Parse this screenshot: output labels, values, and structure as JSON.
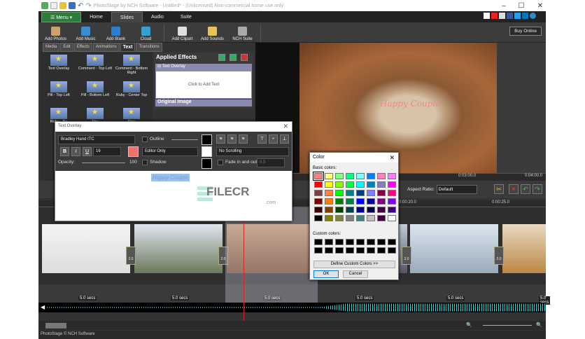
{
  "window": {
    "title": "PhotoStage by NCH Software - Untitled* - (Unlicensed) Non-commercial home use only"
  },
  "menu": {
    "menu_label": "☰ Menu ▾",
    "tabs": [
      "Home",
      "Slides",
      "Audio",
      "Suite"
    ],
    "active_tab": "Slides"
  },
  "toolbar": {
    "buttons": [
      {
        "label": "Add Photos",
        "color": "#c9a36b"
      },
      {
        "label": "Add Music",
        "color": "#3a8fd0"
      },
      {
        "label": "Add Blank",
        "color": "#2a7fd0"
      },
      {
        "label": "Cloud",
        "color": "#3a9fd0"
      },
      {
        "label": "Add Clipart",
        "color": "#e0e0e0"
      },
      {
        "label": "Add Sounds",
        "color": "#e6c450"
      },
      {
        "label": "NCH Suite",
        "color": "#aaaaaa"
      }
    ],
    "buy_online": "Buy Online"
  },
  "left_tabs": [
    "Media",
    "Edit",
    "Effects",
    "Animations",
    "Text",
    "Transitions"
  ],
  "active_left_tab": "Text",
  "effects": [
    "Text Overlay",
    "Comment - Top Left",
    "Comment - Bottom Right",
    "Pill - Top Left",
    "Pill - Bottom Left",
    "Ruby - Center Top",
    "Ruby - Bo",
    "The",
    "Stop"
  ],
  "applied": {
    "title": "Applied Effects",
    "overlay": "⊟ Text Overlay",
    "click_to_add": "Click to Add Text",
    "original": "Original Image"
  },
  "preview": {
    "overlay_text": "Happy Couple",
    "ruler": [
      "0:03:00.0",
      "0:04:00.0"
    ]
  },
  "controls": {
    "aspect_label": "Aspect Ratio:",
    "aspect_value": "Default"
  },
  "timeline": {
    "ruler": [
      "0:00:20.0",
      "0:00:25.0"
    ],
    "durations": [
      "5.0 secs",
      "5.0 secs",
      "5.0 secs",
      "5.0 secs",
      "5.0 secs",
      "5.0 secs"
    ],
    "transition_value": "2.0"
  },
  "status": "PhotoStage © NCH Software",
  "text_overlay_dialog": {
    "title": "Text Overlay",
    "font": "Bradley Hand ITC",
    "size": "16",
    "outline": "Outline",
    "mode": "Editor Only",
    "shadow": "Shadow",
    "opacity_label": "Opacity:",
    "opacity_value": "100",
    "opacity": 1.0,
    "scrolling": "No Scrolling",
    "fade": "Fade in and out",
    "fade_value": "0.5",
    "text": "Happy Couple",
    "text_color": "#f07070",
    "bold": "B",
    "italic": "I",
    "underline": "U"
  },
  "watermark": {
    "text": "FILECR",
    "sub": ".com"
  },
  "color_dialog": {
    "title": "Color",
    "basic_label": "Basic colors:",
    "custom_label": "Custom colors:",
    "define_label": "Define Custom Colors >>",
    "ok": "OK",
    "cancel": "Cancel",
    "basic": [
      "#FF8080",
      "#FFFF80",
      "#80FF80",
      "#00FF80",
      "#80FFFF",
      "#0080FF",
      "#FF80C0",
      "#FF80FF",
      "#FF0000",
      "#FFFF00",
      "#80FF00",
      "#00FF40",
      "#00FFFF",
      "#0080C0",
      "#8080C0",
      "#FF00FF",
      "#804040",
      "#FF8040",
      "#00FF00",
      "#008080",
      "#004080",
      "#8080FF",
      "#800040",
      "#FF0080",
      "#800000",
      "#FF8000",
      "#008000",
      "#008040",
      "#0000FF",
      "#0000A0",
      "#800080",
      "#8000FF",
      "#400000",
      "#804000",
      "#004000",
      "#004040",
      "#000080",
      "#000040",
      "#400040",
      "#400080",
      "#000000",
      "#808000",
      "#808040",
      "#808080",
      "#408080",
      "#C0C0C0",
      "#400040",
      "#FFFFFF"
    ],
    "selected": 0,
    "custom_count": 16
  }
}
